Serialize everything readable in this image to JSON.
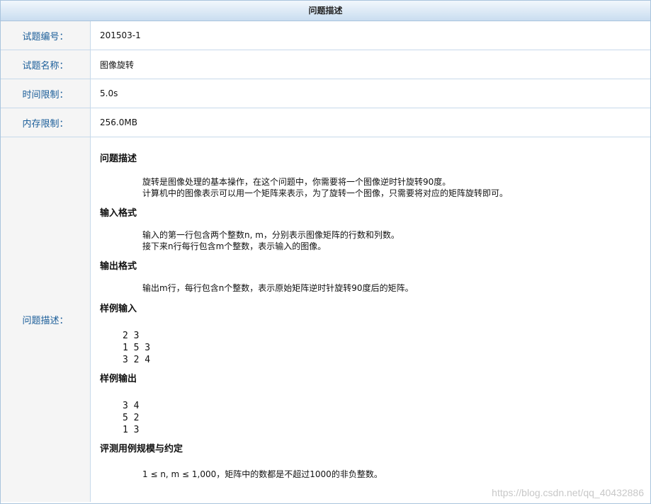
{
  "header": {
    "title": "问题描述"
  },
  "rows": [
    {
      "label": "试题编号：",
      "value": "201503-1"
    },
    {
      "label": "试题名称：",
      "value": "图像旋转"
    },
    {
      "label": "时间限制：",
      "value": "5.0s"
    },
    {
      "label": "内存限制：",
      "value": "256.0MB"
    }
  ],
  "problem": {
    "label": "问题描述：",
    "sections": {
      "desc_title": "问题描述",
      "desc_lines": [
        "旋转是图像处理的基本操作，在这个问题中，你需要将一个图像逆时针旋转90度。",
        "计算机中的图像表示可以用一个矩阵来表示，为了旋转一个图像，只需要将对应的矩阵旋转即可。"
      ],
      "input_title": "输入格式",
      "input_lines": [
        "输入的第一行包含两个整数n, m，分别表示图像矩阵的行数和列数。",
        "接下来n行每行包含m个整数，表示输入的图像。"
      ],
      "output_title": "输出格式",
      "output_lines": [
        "输出m行，每行包含n个整数，表示原始矩阵逆时针旋转90度后的矩阵。"
      ],
      "sample_input_title": "样例输入",
      "sample_input": [
        "2 3",
        "1 5 3",
        "3 2 4"
      ],
      "sample_output_title": "样例输出",
      "sample_output": [
        "3 4",
        "5 2",
        "1 3"
      ],
      "scale_title": "评测用例规模与约定",
      "scale_lines": [
        "1 ≤ n, m ≤ 1,000，矩阵中的数都是不超过1000的非负整数。"
      ]
    }
  },
  "watermark": "https://blog.csdn.net/qq_40432886"
}
